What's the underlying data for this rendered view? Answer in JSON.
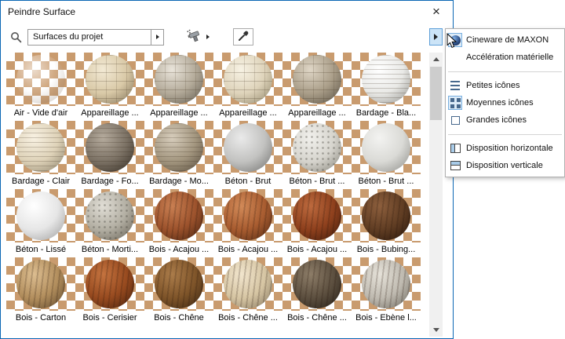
{
  "window": {
    "title": "Peindre Surface",
    "close_label": "×"
  },
  "toolbar": {
    "search_value": "Surfaces du projet"
  },
  "colors": {
    "win_border": "#0a66b4",
    "checker_tan": "#c99b6e",
    "checker_light": "#ffffff",
    "launcher_bg": "#cce4f7",
    "launcher_border": "#5e9fd8",
    "icon_sel_bg": "#dcebf8",
    "icon_sel_border": "#7ab0e0",
    "sb_track": "#f0f0f0",
    "sb_thumb": "#cdcdcd"
  },
  "materials": [
    {
      "label": "Air - Vide d'air",
      "texture": "transparent",
      "c1": "#ffffff",
      "c2": "#ffffff",
      "c3": "#a08460"
    },
    {
      "label": "Appareillage ...",
      "texture": "stone",
      "c1": "#f2e9d4",
      "c2": "#d9c9a7",
      "c3": "#7e6f55"
    },
    {
      "label": "Appareillage ...",
      "texture": "stone",
      "c1": "#e9e4da",
      "c2": "#b3aa99",
      "c3": "#5f584c"
    },
    {
      "label": "Appareillage ...",
      "texture": "stone",
      "c1": "#f7f2e4",
      "c2": "#ded3ba",
      "c3": "#8e8468"
    },
    {
      "label": "Appareillage ...",
      "texture": "stone",
      "c1": "#dfd6c6",
      "c2": "#a99d88",
      "c3": "#574f42"
    },
    {
      "label": "Bardage - Bla...",
      "texture": "lines",
      "c1": "#ffffff",
      "c2": "#e9e9e6",
      "c3": "#8f8f8a"
    },
    {
      "label": "Bardage - Clair",
      "texture": "lines",
      "c1": "#f8f1e2",
      "c2": "#ded2b8",
      "c3": "#8a8069"
    },
    {
      "label": "Bardage - Fo...",
      "texture": "lines",
      "c1": "#b5ab9d",
      "c2": "#7b7164",
      "c3": "#322b22"
    },
    {
      "label": "Bardage - Mo...",
      "texture": "lines",
      "c1": "#d7cdbc",
      "c2": "#a2957e",
      "c3": "#54493a"
    },
    {
      "label": "Béton - Brut",
      "texture": "none",
      "c1": "#eaeaea",
      "c2": "#c2c2c0",
      "c3": "#6f6f6d"
    },
    {
      "label": "Béton - Brut ...",
      "texture": "dots",
      "c1": "#f1f0ec",
      "c2": "#d6d4cd",
      "c3": "#858379"
    },
    {
      "label": "Béton - Brut ...",
      "texture": "none",
      "c1": "#f3f3f1",
      "c2": "#dadad6",
      "c3": "#8b8b87"
    },
    {
      "label": "Béton - Lissé",
      "texture": "none",
      "c1": "#ffffff",
      "c2": "#e6e6e6",
      "c3": "#9b9b9b"
    },
    {
      "label": "Béton - Morti...",
      "texture": "dots",
      "c1": "#e1ded6",
      "c2": "#b2aea2",
      "c3": "#655f53"
    },
    {
      "label": "Bois - Acajou ...",
      "texture": "wood",
      "c1": "#c97f52",
      "c2": "#9c522c",
      "c3": "#47220f"
    },
    {
      "label": "Bois - Acajou ...",
      "texture": "wood",
      "c1": "#d28a58",
      "c2": "#a85c30",
      "c3": "#522812"
    },
    {
      "label": "Bois - Acajou ...",
      "texture": "wood",
      "c1": "#bd6a3e",
      "c2": "#8e401d",
      "c3": "#3f1a0a"
    },
    {
      "label": "Bois - Bubing...",
      "texture": "wood",
      "c1": "#8d5f3d",
      "c2": "#603d23",
      "c3": "#27150a"
    },
    {
      "label": "Bois - Carton",
      "texture": "wood",
      "c1": "#dcbd90",
      "c2": "#b28e5d",
      "c3": "#5d462a"
    },
    {
      "label": "Bois - Cerisier",
      "texture": "wood",
      "c1": "#c4733f",
      "c2": "#974a1f",
      "c3": "#45200c"
    },
    {
      "label": "Bois - Chêne",
      "texture": "wood",
      "c1": "#ab7c4a",
      "c2": "#7e5429",
      "c3": "#382311"
    },
    {
      "label": "Bois - Chêne ...",
      "texture": "wood",
      "c1": "#f1e5cd",
      "c2": "#d6c5a3",
      "c3": "#84765e"
    },
    {
      "label": "Bois - Chêne ...",
      "texture": "wood",
      "c1": "#8d7d68",
      "c2": "#5c4f3f",
      "c3": "#241d15"
    },
    {
      "label": "Bois - Ebène l...",
      "texture": "wood",
      "c1": "#e6e2d9",
      "c2": "#bfbab0",
      "c3": "#6e6a60"
    }
  ],
  "menu": {
    "items": [
      {
        "type": "item",
        "name": "menu-item-cineware-de-maxon",
        "label": "Cineware de MAXON",
        "icon": "cineware-sphere-icon",
        "icon_selected": true
      },
      {
        "type": "item",
        "name": "menu-item-acceleration-materielle",
        "label": "Accélération matérielle",
        "icon": "none"
      },
      {
        "type": "separator"
      },
      {
        "type": "item",
        "name": "menu-item-petites-icones",
        "label": "Petites icônes",
        "icon": "small-icons-icon"
      },
      {
        "type": "item",
        "name": "menu-item-moyennes-icones",
        "label": "Moyennes icônes",
        "icon": "medium-icons-icon",
        "icon_selected": true
      },
      {
        "type": "item",
        "name": "menu-item-grandes-icones",
        "label": "Grandes icônes",
        "icon": "large-icons-icon"
      },
      {
        "type": "separator"
      },
      {
        "type": "item",
        "name": "menu-item-disposition-horizontale",
        "label": "Disposition horizontale",
        "icon": "layout-horizontal-icon"
      },
      {
        "type": "item",
        "name": "menu-item-disposition-verticale",
        "label": "Disposition verticale",
        "icon": "layout-vertical-icon"
      }
    ]
  }
}
